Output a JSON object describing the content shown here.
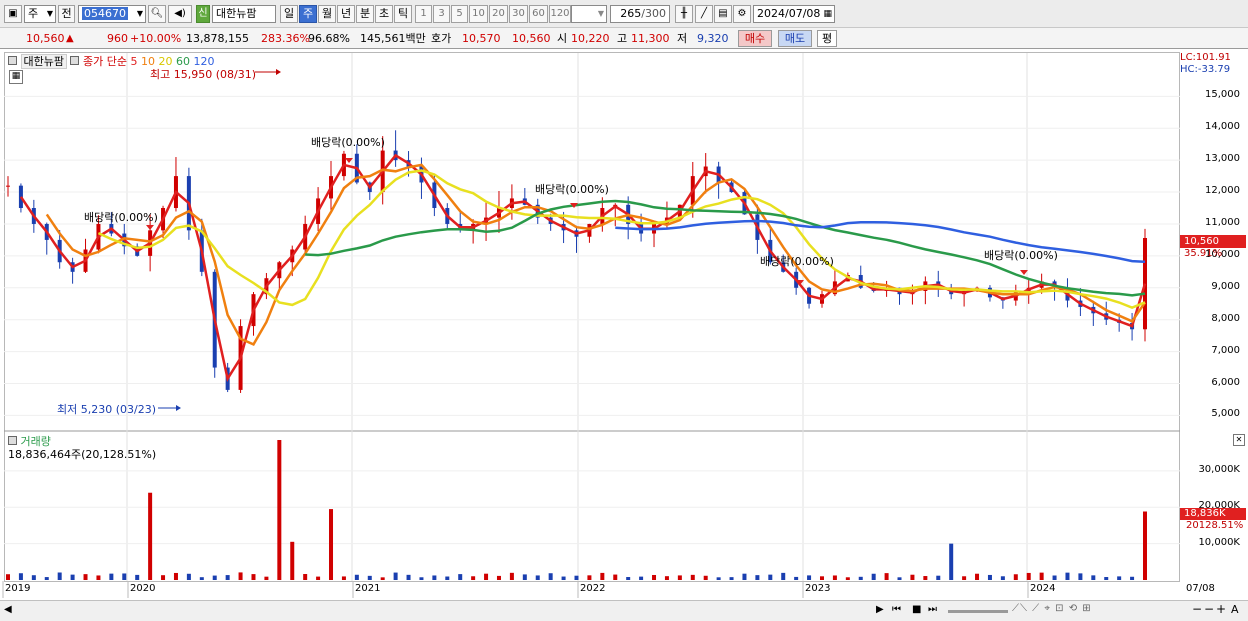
{
  "toolbar": {
    "period_select": "주",
    "prev_label": "전",
    "stock_code": "054670",
    "stock_name": "대한뉴팜",
    "credit_badge": "신",
    "periods": [
      {
        "label": "일",
        "selected": false
      },
      {
        "label": "주",
        "selected": true
      },
      {
        "label": "월",
        "selected": false
      },
      {
        "label": "년",
        "selected": false
      },
      {
        "label": "분",
        "selected": false
      },
      {
        "label": "초",
        "selected": false
      },
      {
        "label": "틱",
        "selected": false
      }
    ],
    "intervals": [
      "1",
      "3",
      "5",
      "10",
      "20",
      "30",
      "60",
      "120"
    ],
    "count_value": "265",
    "count_total": "/300",
    "date_value": "2024/07/08"
  },
  "quote": {
    "price": "10,560",
    "change": "960",
    "change_rate": "+10.00%",
    "volume": "13,878,155",
    "volume_ratio": "283.36%",
    "ratio2": "96.68%",
    "amount": "145,561백만",
    "ask_label": "호가",
    "ask_price": "10,570",
    "bid_price": "10,560",
    "open_label": "시",
    "open": "10,220",
    "high_label": "고",
    "high": "11,300",
    "low_label": "저",
    "low": "9,320",
    "buy_label": "매수",
    "sell_label": "매도",
    "eval_label": "평"
  },
  "legend": {
    "stock_name": "대한뉴팜",
    "ma_title": "종가 단순",
    "ma_periods": [
      "5",
      "10",
      "20",
      "60",
      "120"
    ],
    "ma_colors": [
      "#e02020",
      "#f08010",
      "#e8e020",
      "#2a9a4a",
      "#2f5fe0"
    ]
  },
  "annotations": {
    "high": "최고 15,950 (08/31)",
    "low": "최저 5,230 (03/23)",
    "dividends": [
      "배당락(0.00%)",
      "배당락(0.00%)",
      "배당락(0.00%)",
      "배당락(0.00%)",
      "배당락(0.00%)"
    ]
  },
  "price_axis": {
    "lc": "LC:101.91",
    "hc": "HC:-33.79",
    "ticks": [
      "15,000",
      "14,000",
      "13,000",
      "12,000",
      "11,000",
      "10,000",
      "9,000",
      "8,000",
      "7,000",
      "6,000",
      "5,000"
    ],
    "current_price": "10,560",
    "current_pct": "35.91%"
  },
  "volume_panel": {
    "title": "거래량",
    "current": "18,836,464주(20,128.51%)",
    "ticks": [
      "30,000K",
      "20,000K",
      "10,000K"
    ],
    "current_tag": "18,836K",
    "current_pct": "20128.51%"
  },
  "time_axis": {
    "labels": [
      "2019",
      "2020",
      "2021",
      "2022",
      "2023",
      "2024"
    ],
    "right_label": "07/08"
  },
  "colors": {
    "up": "#d00000",
    "down": "#1a3fb0",
    "selected": "#3b6fd1"
  },
  "chart_data": {
    "type": "candlestick",
    "period": "weekly",
    "x_range": [
      "2019-01",
      "2024-07-08"
    ],
    "ylim": [
      4700,
      15900
    ],
    "weekly_closes_estimated": [
      12200,
      11500,
      11000,
      10500,
      9800,
      9500,
      10200,
      11000,
      10700,
      10300,
      10000,
      10800,
      11500,
      12500,
      10800,
      9500,
      6500,
      5800,
      7800,
      8800,
      9300,
      9800,
      10200,
      11000,
      11800,
      12500,
      13200,
      12300,
      12000,
      13300,
      13000,
      12800,
      12300,
      11500,
      11000,
      10800,
      11000,
      11200,
      11500,
      11800,
      11600,
      11200,
      11000,
      10800,
      10600,
      11000,
      11500,
      11600,
      11000,
      10700,
      11000,
      11200,
      11600,
      12500,
      12800,
      12300,
      12000,
      11300,
      10500,
      9800,
      9500,
      9000,
      8500,
      8800,
      9200,
      9400,
      9000,
      8900,
      9000,
      8800,
      8900,
      9200,
      9000,
      8800,
      8900,
      9000,
      8700,
      8600,
      8900,
      9000,
      9200,
      9000,
      8600,
      8400,
      8200,
      8000,
      7900,
      7700,
      10560
    ],
    "moving_averages": [
      {
        "name": "5",
        "color": "#e02020"
      },
      {
        "name": "10",
        "color": "#f08010"
      },
      {
        "name": "20",
        "color": "#e8e020"
      },
      {
        "name": "60",
        "color": "#2a9a4a"
      },
      {
        "name": "120",
        "color": "#2f5fe0"
      }
    ],
    "high_point": {
      "value": 15950,
      "date": "08/31"
    },
    "low_point": {
      "value": 5230,
      "date": "03/23"
    },
    "last_close": 10560,
    "volume_ylim": [
      0,
      38000
    ],
    "volume_spikes_k": [
      {
        "period": "2020-01",
        "value": 24000
      },
      {
        "period": "2020-05",
        "value": 38500
      },
      {
        "period": "2020-06",
        "value": 10500
      },
      {
        "period": "2020-08",
        "value": 19500
      },
      {
        "period": "2023-10",
        "value": 10000
      },
      {
        "period": "2024-07",
        "value": 18836
      }
    ]
  }
}
